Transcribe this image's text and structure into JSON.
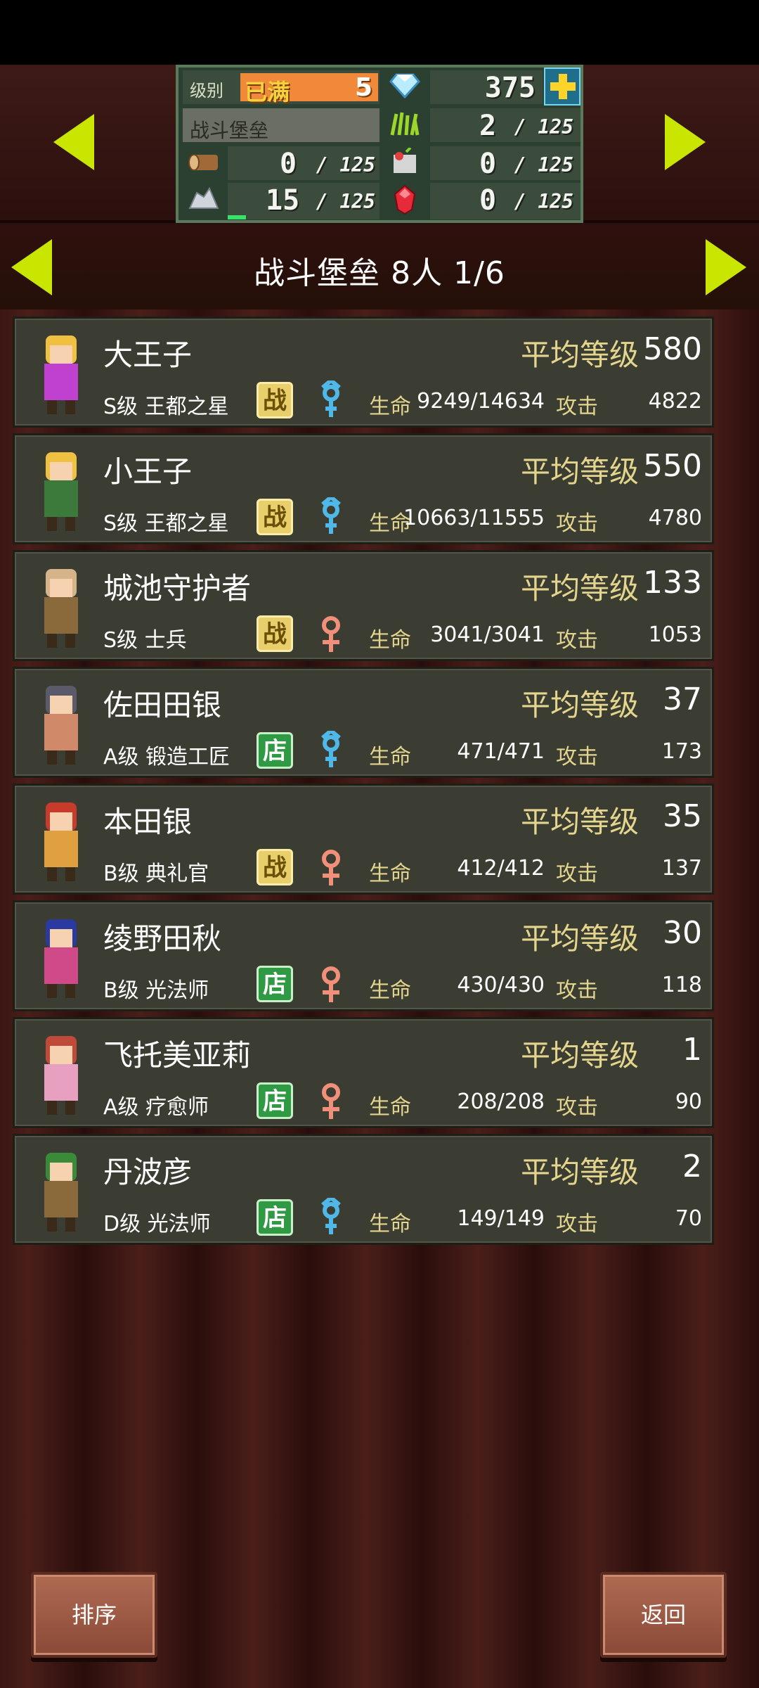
{
  "resources": {
    "level_label": "级别",
    "level_max_label": "已满",
    "level_value": "5",
    "gem_value": "375",
    "building_name": "战斗堡垒",
    "grass": {
      "value": "2",
      "cap": "/ 125"
    },
    "wood": {
      "value": "0",
      "cap": "/ 125"
    },
    "food": {
      "value": "0",
      "cap": "/ 125"
    },
    "ore": {
      "value": "15",
      "cap": "/ 125"
    },
    "ruby": {
      "value": "0",
      "cap": "/ 125"
    },
    "ore_progress": 0.12
  },
  "header": {
    "title": "战斗堡垒  8人 1/6"
  },
  "units": [
    {
      "name": "大王子",
      "level_label": "平均等级",
      "level": "580",
      "rank": "S级 王都之星",
      "badge": "战",
      "badge_type": "battle",
      "gender": "male",
      "hp_label": "生命",
      "hp": "9249/14634",
      "atk_label": "攻击",
      "atk": "4822"
    },
    {
      "name": "小王子",
      "level_label": "平均等级",
      "level": "550",
      "rank": "S级 王都之星",
      "badge": "战",
      "badge_type": "battle",
      "gender": "male",
      "hp_label": "生命",
      "hp": "10663/11555",
      "atk_label": "攻击",
      "atk": "4780"
    },
    {
      "name": "城池守护者",
      "level_label": "平均等级",
      "level": "133",
      "rank": "S级 士兵",
      "badge": "战",
      "badge_type": "battle",
      "gender": "female",
      "hp_label": "生命",
      "hp": "3041/3041",
      "atk_label": "攻击",
      "atk": "1053"
    },
    {
      "name": "佐田田银",
      "level_label": "平均等级",
      "level": "37",
      "rank": "A级 锻造工匠",
      "badge": "店",
      "badge_type": "shop",
      "gender": "male",
      "hp_label": "生命",
      "hp": "471/471",
      "atk_label": "攻击",
      "atk": "173"
    },
    {
      "name": "本田银",
      "level_label": "平均等级",
      "level": "35",
      "rank": "B级 典礼官",
      "badge": "战",
      "badge_type": "battle",
      "gender": "female",
      "hp_label": "生命",
      "hp": "412/412",
      "atk_label": "攻击",
      "atk": "137"
    },
    {
      "name": "绫野田秋",
      "level_label": "平均等级",
      "level": "30",
      "rank": "B级 光法师",
      "badge": "店",
      "badge_type": "shop",
      "gender": "female",
      "hp_label": "生命",
      "hp": "430/430",
      "atk_label": "攻击",
      "atk": "118"
    },
    {
      "name": "飞托美亚莉",
      "level_label": "平均等级",
      "level": "1",
      "rank": "A级 疗愈师",
      "badge": "店",
      "badge_type": "shop",
      "gender": "female",
      "hp_label": "生命",
      "hp": "208/208",
      "atk_label": "攻击",
      "atk": "90"
    },
    {
      "name": "丹波彦",
      "level_label": "平均等级",
      "level": "2",
      "rank": "D级 光法师",
      "badge": "店",
      "badge_type": "shop",
      "gender": "male",
      "hp_label": "生命",
      "hp": "149/149",
      "atk_label": "攻击",
      "atk": "70"
    }
  ],
  "buttons": {
    "sort": "排序",
    "back": "返回"
  },
  "colors": {
    "accent_arrow": "#c9e600",
    "label_gold": "#e3d58e",
    "male": "#4fb8e8",
    "female": "#f08f7a"
  }
}
